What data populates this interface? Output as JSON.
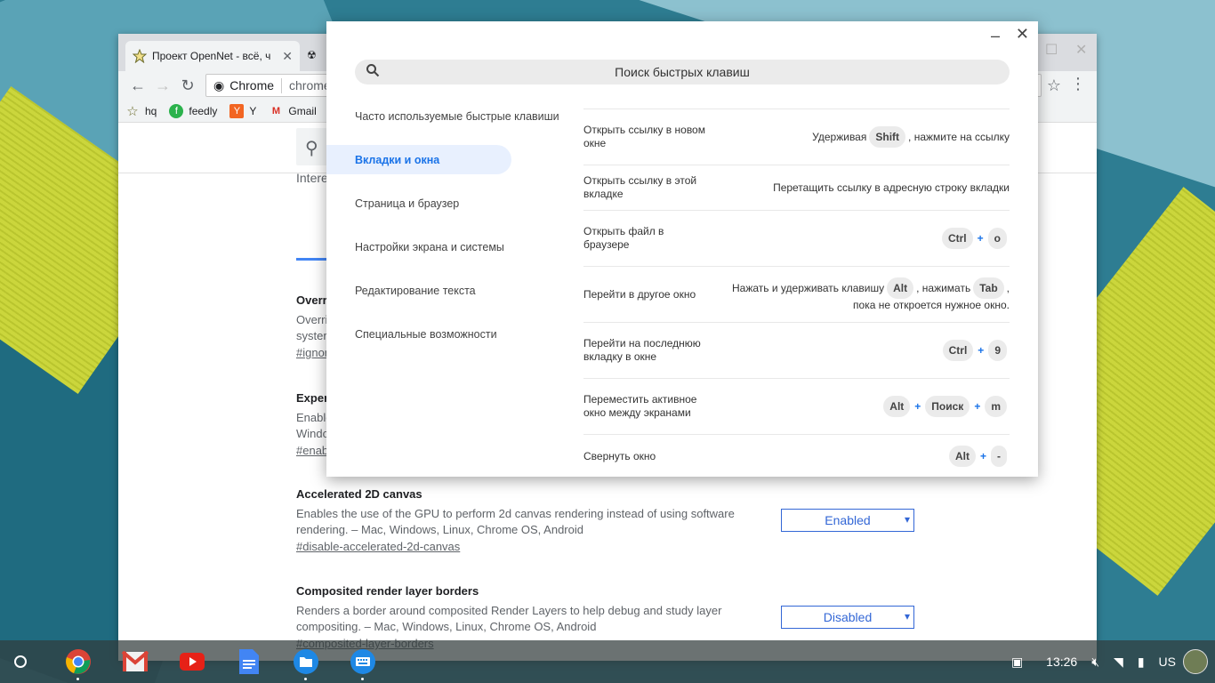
{
  "browser": {
    "tabs": [
      {
        "title": "Проект OpenNet - всё, ч"
      },
      {
        "title": ""
      }
    ],
    "omnibox": {
      "chip": "Chrome",
      "url": "chrome:"
    },
    "bookmarks": [
      {
        "label": "hq"
      },
      {
        "label": "feedly"
      },
      {
        "label": "Y"
      },
      {
        "label": "Gmail"
      }
    ]
  },
  "flags_page": {
    "search_partial": "Intere",
    "flags": [
      {
        "title": "Overri",
        "desc_lines": [
          "Overri",
          "syster"
        ],
        "anchor": "#ignor"
      },
      {
        "title": "Exper",
        "desc_lines": [
          "Enable",
          "Windo"
        ],
        "anchor": "#enab"
      },
      {
        "title": "Accelerated 2D canvas",
        "desc_lines": [
          "Enables the use of the GPU to perform 2d canvas rendering instead of using software",
          "rendering. – Mac, Windows, Linux, Chrome OS, Android"
        ],
        "anchor": "#disable-accelerated-2d-canvas",
        "value": "Enabled"
      },
      {
        "title": "Composited render layer borders",
        "desc_lines": [
          "Renders a border around composited Render Layers to help debug and study layer",
          "compositing. – Mac, Windows, Linux, Chrome OS, Android"
        ],
        "anchor": "#composited-layer-borders",
        "value": "Disabled"
      }
    ]
  },
  "shortcut_viewer": {
    "search_placeholder": "Поиск быстрых клавиш",
    "categories": [
      "Часто используемые быстрые клавиши",
      "Вкладки и окна",
      "Страница и браузер",
      "Настройки экрана и системы",
      "Редактирование текста",
      "Специальные возможности"
    ],
    "active_category": "Вкладки и окна",
    "shortcuts": [
      {
        "desc": "Открыть ссылку в новом окне",
        "pre": "Удерживая",
        "keys": [
          "Shift"
        ],
        "post": ", нажмите на ссылку"
      },
      {
        "desc": "Открыть ссылку в этой вкладке",
        "text": "Перетащить ссылку в адресную строку вкладки"
      },
      {
        "desc": "Открыть файл в браузере",
        "keys": [
          "Ctrl",
          "o"
        ]
      },
      {
        "desc": "Перейти в другое окно",
        "pre": "Нажать и удерживать клавишу",
        "key1": "Alt",
        "mid": ", нажимать",
        "key2": "Tab",
        "post": ",",
        "line2": "пока не откроется нужное окно."
      },
      {
        "desc": "Перейти на последнюю вкладку в окне",
        "keys": [
          "Ctrl",
          "9"
        ]
      },
      {
        "desc": "Переместить активное окно между экранами",
        "keys": [
          "Alt",
          "Поиск",
          "m"
        ]
      },
      {
        "desc": "Свернуть окно",
        "keys": [
          "Alt",
          "-"
        ]
      }
    ],
    "plus": "+"
  },
  "shelf": {
    "apps": [
      "chrome-icon",
      "gmail-icon",
      "youtube-icon",
      "docs-icon",
      "files-icon",
      "keyboard-icon"
    ],
    "time": "13:26",
    "ime": "US"
  },
  "colors": {
    "accent": "#1a73e8",
    "active_bg": "#e8f0fe"
  }
}
